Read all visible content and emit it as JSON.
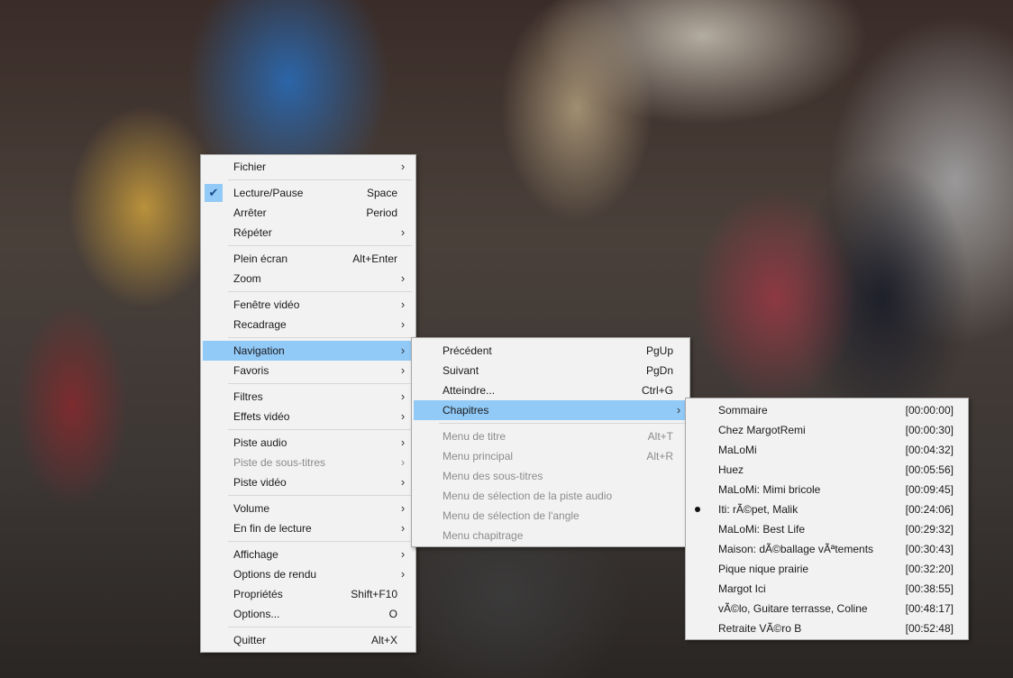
{
  "main_menu": {
    "items": [
      {
        "label": "Fichier",
        "shortcut": "",
        "submenu": true
      },
      {
        "label": "Lecture/Pause",
        "shortcut": "Space",
        "checked": true
      },
      {
        "label": "Arrêter",
        "shortcut": "Period"
      },
      {
        "label": "Répéter",
        "shortcut": "",
        "submenu": true
      },
      {
        "label": "Plein écran",
        "shortcut": "Alt+Enter"
      },
      {
        "label": "Zoom",
        "shortcut": "",
        "submenu": true
      },
      {
        "label": "Fenêtre vidéo",
        "shortcut": "",
        "submenu": true
      },
      {
        "label": "Recadrage",
        "shortcut": "",
        "submenu": true
      },
      {
        "label": "Navigation",
        "shortcut": "",
        "submenu": true,
        "highlighted": true
      },
      {
        "label": "Favoris",
        "shortcut": "",
        "submenu": true
      },
      {
        "label": "Filtres",
        "shortcut": "",
        "submenu": true
      },
      {
        "label": "Effets vidéo",
        "shortcut": "",
        "submenu": true
      },
      {
        "label": "Piste audio",
        "shortcut": "",
        "submenu": true
      },
      {
        "label": "Piste de sous-titres",
        "shortcut": "",
        "submenu": true,
        "disabled": true
      },
      {
        "label": "Piste vidéo",
        "shortcut": "",
        "submenu": true
      },
      {
        "label": "Volume",
        "shortcut": "",
        "submenu": true
      },
      {
        "label": "En fin de lecture",
        "shortcut": "",
        "submenu": true
      },
      {
        "label": "Affichage",
        "shortcut": "",
        "submenu": true
      },
      {
        "label": "Options de rendu",
        "shortcut": "",
        "submenu": true
      },
      {
        "label": "Propriétés",
        "shortcut": "Shift+F10"
      },
      {
        "label": "Options...",
        "shortcut": "O"
      },
      {
        "label": "Quitter",
        "shortcut": "Alt+X"
      }
    ]
  },
  "navigation_menu": {
    "items": [
      {
        "label": "Précédent",
        "shortcut": "PgUp"
      },
      {
        "label": "Suivant",
        "shortcut": "PgDn"
      },
      {
        "label": "Atteindre...",
        "shortcut": "Ctrl+G"
      },
      {
        "label": "Chapitres",
        "shortcut": "",
        "submenu": true,
        "highlighted": true
      },
      {
        "label": "Menu de titre",
        "shortcut": "Alt+T",
        "disabled": true
      },
      {
        "label": "Menu principal",
        "shortcut": "Alt+R",
        "disabled": true
      },
      {
        "label": "Menu des sous-titres",
        "shortcut": "",
        "disabled": true
      },
      {
        "label": "Menu de sélection de la piste audio",
        "shortcut": "",
        "disabled": true
      },
      {
        "label": "Menu de sélection de l'angle",
        "shortcut": "",
        "disabled": true
      },
      {
        "label": "Menu chapitrage",
        "shortcut": "",
        "disabled": true
      }
    ]
  },
  "chapters_menu": {
    "items": [
      {
        "label": "Sommaire",
        "time": "[00:00:00]"
      },
      {
        "label": "Chez MargotRemi",
        "time": "[00:00:30]"
      },
      {
        "label": "MaLoMi",
        "time": "[00:04:32]"
      },
      {
        "label": "Huez",
        "time": "[00:05:56]"
      },
      {
        "label": "MaLoMi: Mimi bricole",
        "time": "[00:09:45]"
      },
      {
        "label": "Iti: rÃ©pet, Malik",
        "time": "[00:24:06]",
        "selected": true
      },
      {
        "label": "MaLoMi: Best Life",
        "time": "[00:29:32]"
      },
      {
        "label": "Maison: dÃ©ballage vÃªtements",
        "time": "[00:30:43]"
      },
      {
        "label": "Pique nique prairie",
        "time": "[00:32:20]"
      },
      {
        "label": "Margot Ici",
        "time": "[00:38:55]"
      },
      {
        "label": "vÃ©lo, Guitare terrasse, Coline",
        "time": "[00:48:17]"
      },
      {
        "label": "Retraite VÃ©ro B",
        "time": "[00:52:48]"
      }
    ]
  },
  "icons": {
    "check": "check-icon",
    "arrow": "chevron-right-icon",
    "bullet": "radio-bullet-icon"
  },
  "colors": {
    "highlight": "#91c9f7",
    "menu_bg": "#f2f2f2",
    "disabled_text": "#8c8c8c"
  }
}
